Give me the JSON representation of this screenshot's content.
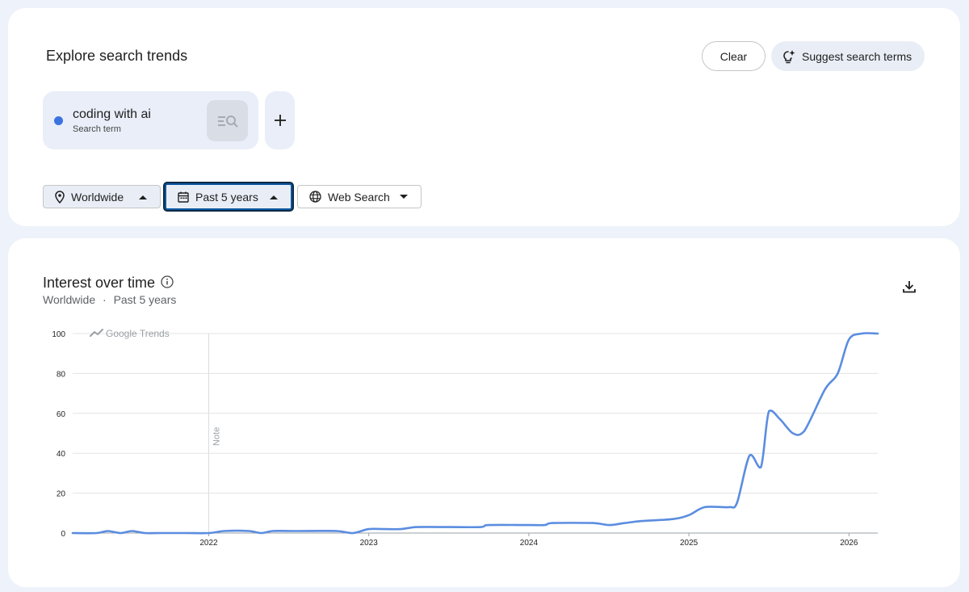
{
  "explore": {
    "title": "Explore search trends",
    "clear_label": "Clear",
    "suggest_label": "Suggest search terms",
    "term": {
      "name": "coding with ai",
      "type": "Search term",
      "color": "#3b73e0"
    },
    "filters": {
      "location": "Worldwide",
      "time_range": "Past 5 years",
      "property": "Web Search"
    }
  },
  "chart": {
    "title": "Interest over time",
    "subtitle_location": "Worldwide",
    "subtitle_separator": "·",
    "subtitle_range": "Past 5 years",
    "watermark": "Google Trends",
    "note_label": "Note"
  },
  "chart_data": {
    "type": "line",
    "title": "Interest over time",
    "xlabel": "",
    "ylabel": "",
    "ylim": [
      0,
      100
    ],
    "yticks": [
      0,
      20,
      40,
      60,
      80,
      100
    ],
    "xlim": [
      2021.15,
      2026.18
    ],
    "xticks": [
      "2022",
      "2023",
      "2024",
      "2025",
      "2026"
    ],
    "grid": true,
    "series": [
      {
        "color": "#5b8de0",
        "x": [
          2021.15,
          2021.3,
          2021.37,
          2021.45,
          2021.52,
          2021.6,
          2021.7,
          2021.85,
          2022.0,
          2022.1,
          2022.25,
          2022.33,
          2022.4,
          2022.55,
          2022.8,
          2022.9,
          2023.0,
          2023.1,
          2023.2,
          2023.3,
          2023.5,
          2023.7,
          2023.75,
          2024.0,
          2024.1,
          2024.15,
          2024.4,
          2024.5,
          2024.6,
          2024.7,
          2024.9,
          2025.0,
          2025.1,
          2025.25,
          2025.3,
          2025.38,
          2025.45,
          2025.5,
          2025.57,
          2025.65,
          2025.72,
          2025.85,
          2025.93,
          2026.0,
          2026.08,
          2026.18
        ],
        "y": [
          0,
          0,
          1,
          0,
          1,
          0,
          0,
          0,
          0,
          1,
          1,
          0,
          1,
          1,
          1,
          0,
          2,
          2,
          2,
          3,
          3,
          3,
          4,
          4,
          4,
          5,
          5,
          4,
          5,
          6,
          7,
          9,
          13,
          13,
          15,
          39,
          33,
          61,
          57,
          50,
          51,
          72,
          80,
          97,
          100,
          100
        ]
      }
    ],
    "annotations": [
      {
        "x": 2022.0,
        "label": "Note"
      }
    ]
  }
}
